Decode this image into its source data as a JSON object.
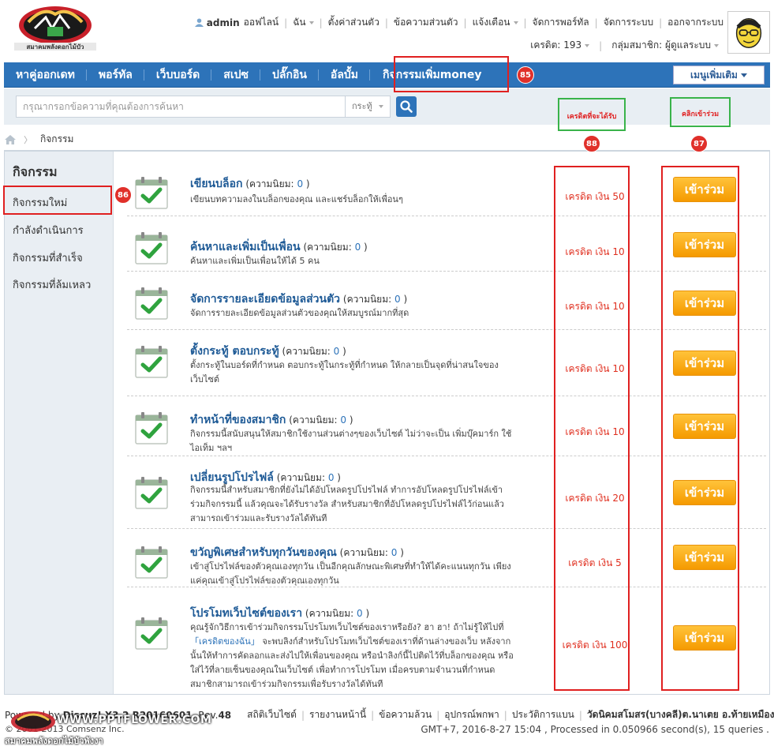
{
  "header": {
    "user": "admin",
    "online": "ออฟไลน์",
    "links": [
      "ฉัน",
      "ตั้งค่าส่วนตัว",
      "ข้อความส่วนตัว",
      "แจ้งเตือน",
      "จัดการพอร์ทัล",
      "จัดการระบบ",
      "ออกจากระบบ"
    ],
    "credit": "เครดิต: 193",
    "group": "กลุ่มสมาชิก: ผู้ดูแลระบบ"
  },
  "nav": {
    "items": [
      "หาคู่ออกเดท",
      "พอร์ทัล",
      "เว็บบอร์ด",
      "สเปซ",
      "ปลั๊กอิน",
      "อัลบั้ม",
      "กิจกรรมเพิ่มmoney"
    ],
    "more": "เมนูเพิ่มเติม"
  },
  "search": {
    "placeholder": "กรุณากรอกข้อความที่คุณต้องการค้นหา",
    "scope": "กระทู้"
  },
  "breadcrumb": "กิจกรรม",
  "sidebar": {
    "title": "กิจกรรม",
    "items": [
      "กิจกรรมใหม่",
      "กำลังดำเนินการ",
      "กิจกรรมที่สำเร็จ",
      "กิจกรรมที่ล้มเหลว"
    ]
  },
  "annotations": {
    "n85": "85",
    "n86": "86",
    "n87": "87",
    "n88": "88",
    "credit_label": "เครดิตที่จะได้รับ",
    "click_label": "คลิกเข้าร่วม"
  },
  "tasks": {
    "popularity_label": "ความนิยม:",
    "join_label": "เข้าร่วม",
    "items": [
      {
        "name": "เขียนบล็อก",
        "pop": "0",
        "desc": "เขียนบทความลงในบล็อกของคุณ และแชร์บล็อกให้เพื่อนๆ",
        "credit": "เครดิต เงิน 50"
      },
      {
        "name": "ค้นหาและเพิ่มเป็นเพื่อน",
        "pop": "0",
        "desc": "ค้นหาและเพิ่มเป็นเพื่อนให้ได้ 5 คน",
        "credit": "เครดิต เงิน 10"
      },
      {
        "name": "จัดการรายละเอียดข้อมูลส่วนตัว",
        "pop": "0",
        "desc": "จัดการรายละเอียดข้อมูลส่วนตัวของคุณให้สมบูรณ์มากที่สุด",
        "credit": "เครดิต เงิน 10"
      },
      {
        "name": "ตั้งกระทู้ ตอบกระทู้",
        "pop": "0",
        "desc": "ตั้งกระทู้ในบอร์ดที่กำหนด ตอบกระทู้ในกระทู้ที่กำหนด ให้กลายเป็นจุดที่น่าสนใจของเว็บไซต์",
        "credit": "เครดิต เงิน 10"
      },
      {
        "name": "ทำหน้าที่ของสมาชิก",
        "pop": "0",
        "desc": "กิจกรรมนี้สนับสนุนให้สมาชิกใช้งานส่วนต่างๆของเว็บไซต์ ไม่ว่าจะเป็น เพิ่มบุ๊คมาร์ก ใช้ไอเท็ม ฯลฯ",
        "credit": "เครดิต เงิน 10"
      },
      {
        "name": "เปลี่ยนรูปโปรไฟล์",
        "pop": "0",
        "desc": "กิจกรรมนี้สำหรับสมาชิกที่ยังไม่ได้อัปโหลดรูปโปรไฟล์ ทำการอัปโหลดรูปโปรไฟล์เข้าร่วมกิจกรรมนี้ แล้วคุณจะได้รับรางวัล สำหรับสมาชิกที่อัปโหลดรูปโปรไฟล์ไว้ก่อนแล้ว สามารถเข้าร่วมและรับรางวัลได้ทันที",
        "credit": "เครดิต เงิน 20"
      },
      {
        "name": "ขวัญพิเศษสำหรับทุกวันของคุณ",
        "pop": "0",
        "desc": "เข้าสู่โปรไฟล์ของตัวคุณเองทุกวัน เป็นอีกคุณลักษณะพิเศษที่ทำให้ได้คะแนนทุกวัน เพียงแค่คุณเข้าสู่โปรไฟล์ของตัวคุณเองทุกวัน",
        "credit": "เครดิต เงิน 5"
      },
      {
        "name": "โปรโมทเว็บไซต์ของเรา",
        "pop": "0",
        "desc_pre": "คุณรู้จักวิธีการเข้าร่วมกิจกรรมโปรโมทเว็บไซต์ของเราหรือยัง? ฮา ฮา! ถ้าไม่รู้ให้ไปที่ ",
        "desc_link": "「เครดิตของฉัน」",
        "desc_post": " จะพบลิงก์สำหรับโปรโมทเว็บไซต์ของเราที่ด้านล่างของเว็บ หลังจากนั้นให้ทำการคัดลอกและส่งไปให้เพื่อนของคุณ หรือนำลิงก์นี้ไปติดไว้ที่บล็อกของคุณ หรือใส่ไว้ที่ลายเซ็นของคุณในเว็บไซต์ เพื่อทำการโปรโมท เมื่อครบตามจำนวนที่กำหนดสมาชิกสามารถเข้าร่วมกิจกรรมเพื่อรับรางวัลได้ทันที",
        "credit": "เครดิต เงิน 100"
      }
    ]
  },
  "footer": {
    "powered_pre": "Powered by",
    "powered_name": "Discuz!",
    "version": "X3.2 R20160601",
    "rev_label": ", Rev.",
    "rev": "48",
    "links": [
      "สถิติเว็บไซต์",
      "รายงานหน้านี้",
      "ข้อความล้วน",
      "อุปกรณ์พกพา",
      "ประวัติการแบน"
    ],
    "org": "วัดนิคมสโมสร(บางคลี)ต.นาเตย อ.ท้ายเหมือง จ.พังงา",
    "copyright": "© 2001-2013 Comsenz Inc.",
    "stats": "GMT+7, 2016-8-27 15:04 , Processed in 0.050966 second(s), 15 queries .",
    "watermark_url": "WWW.PPTFLOWER.COM",
    "watermark_sub": "สมาคมพลังดอกไม้บัวพังงา"
  },
  "colors": {
    "nav_blue": "#2d73b9",
    "join_orange": "#f59a00",
    "credit_red": "#e03020",
    "annotation_red": "#e02020",
    "annotation_green": "#39b34a"
  }
}
